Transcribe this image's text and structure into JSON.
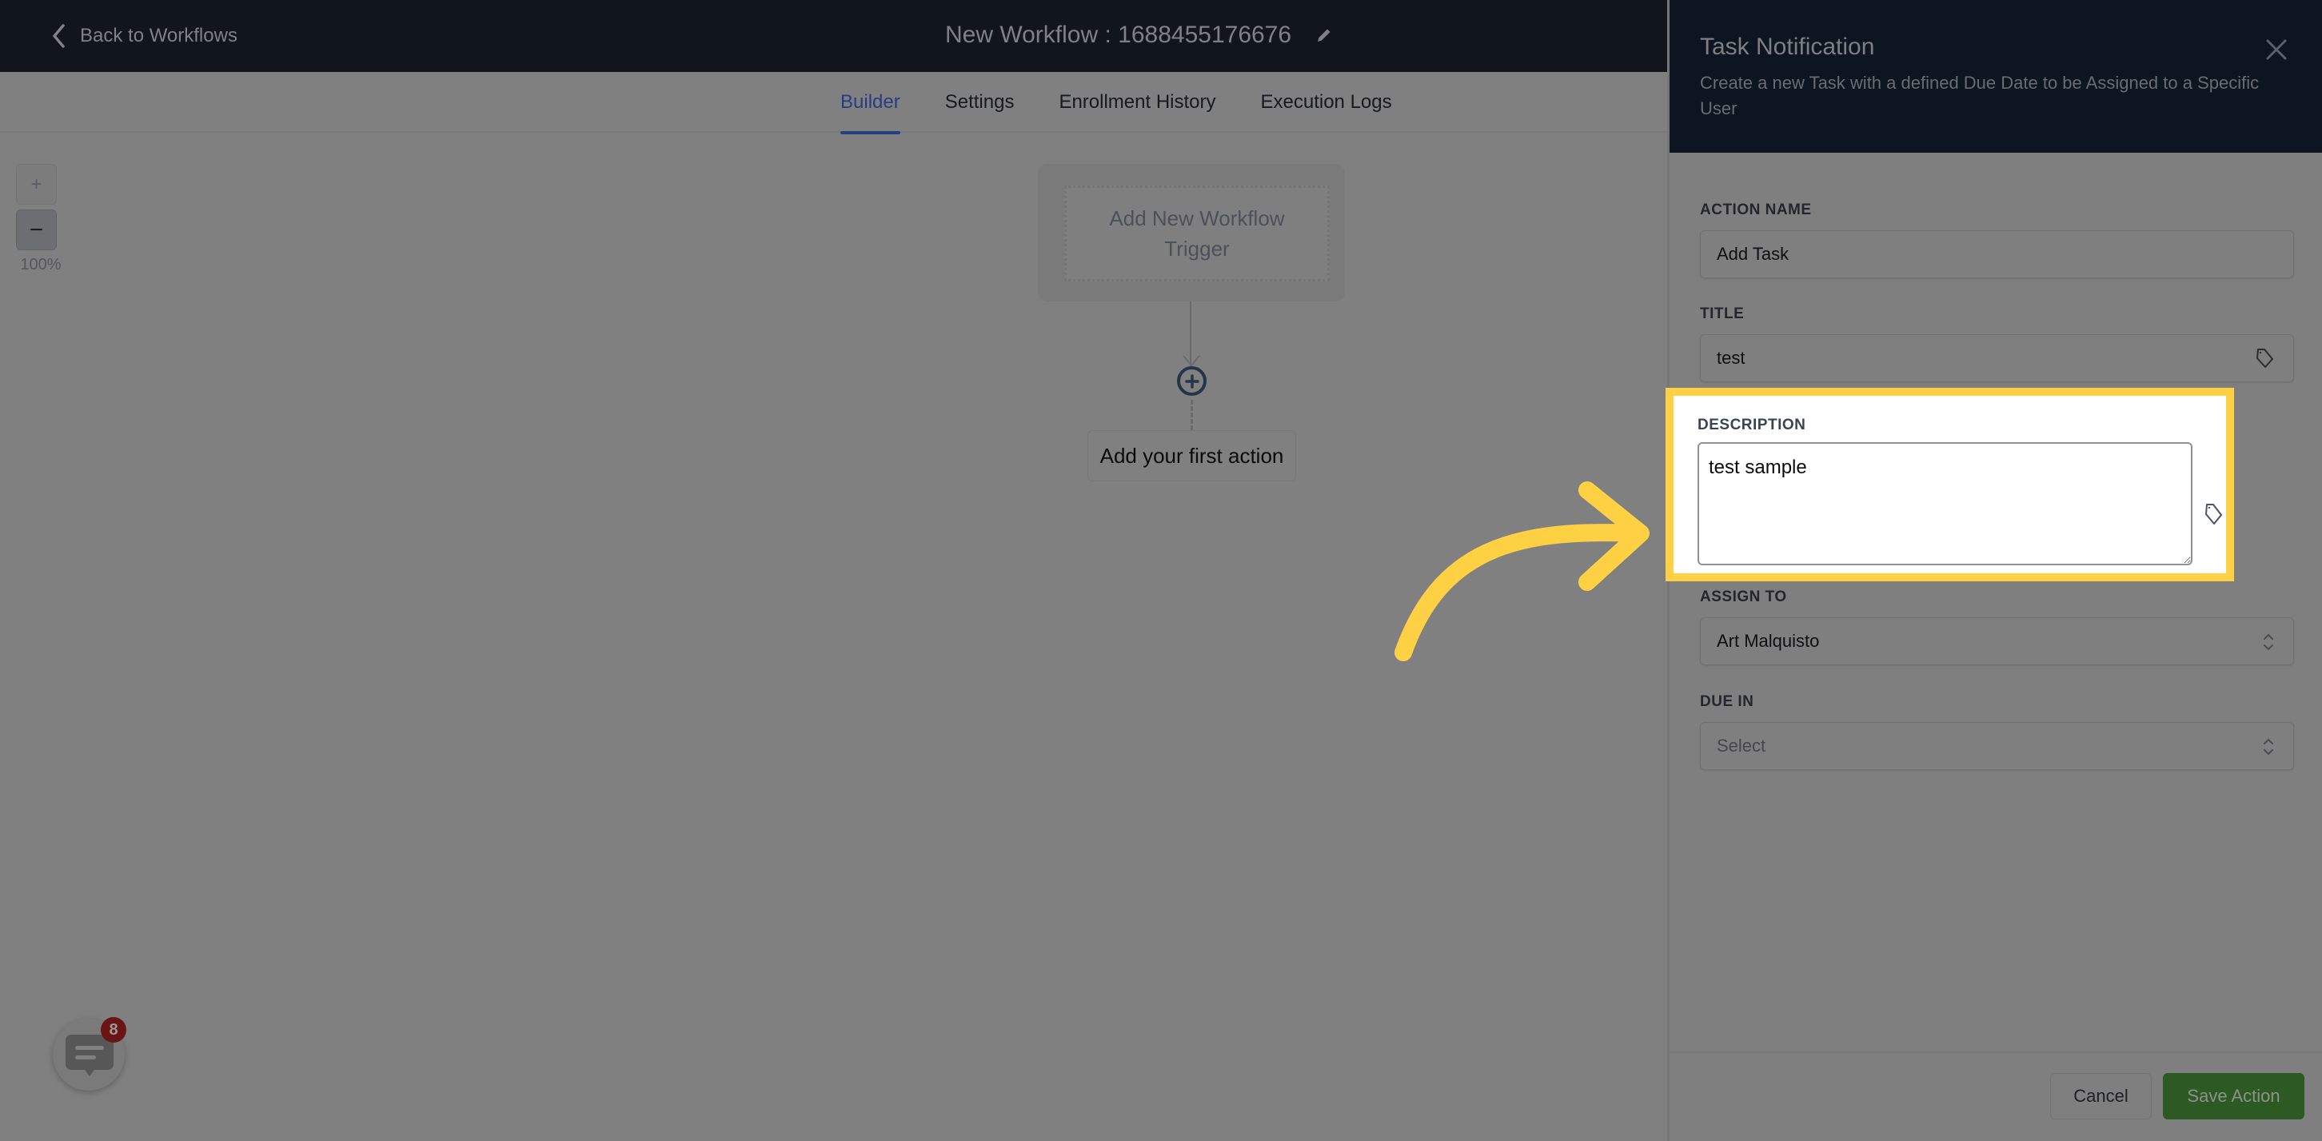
{
  "topbar": {
    "back_label": "Back to Workflows",
    "workflow_title": "New Workflow : 1688455176676"
  },
  "tabs": [
    {
      "label": "Builder",
      "active": true
    },
    {
      "label": "Settings",
      "active": false
    },
    {
      "label": "Enrollment History",
      "active": false
    },
    {
      "label": "Execution Logs",
      "active": false
    }
  ],
  "canvas": {
    "zoom_in_label": "+",
    "zoom_out_label": "−",
    "zoom_level": "100%",
    "trigger_line1": "Add New Workflow",
    "trigger_line2": "Trigger",
    "first_action_label": "Add your first action"
  },
  "chat_widget": {
    "badge_count": "8"
  },
  "panel": {
    "title": "Task Notification",
    "description": "Create a new Task with a defined Due Date to be Assigned to a Specific User",
    "fields": {
      "action_name": {
        "label": "ACTION NAME",
        "value": "Add Task"
      },
      "title": {
        "label": "TITLE",
        "value": "test"
      },
      "description": {
        "label": "DESCRIPTION",
        "value": "test sample"
      },
      "assign_to": {
        "label": "ASSIGN TO",
        "value": "Art Malquisto"
      },
      "due_in": {
        "label": "DUE IN",
        "placeholder": "Select"
      }
    },
    "cancel_label": "Cancel",
    "save_label": "Save Action"
  },
  "colors": {
    "accent": "#263d85",
    "save_button": "#2d5a23",
    "highlight": "#fed144",
    "badge": "#6b1414"
  }
}
